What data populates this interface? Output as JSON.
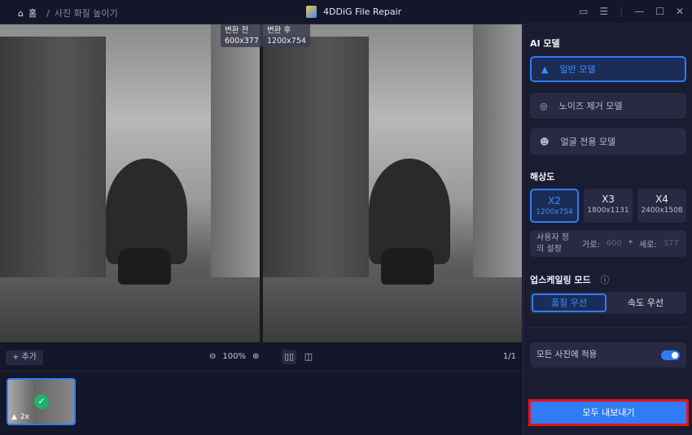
{
  "titlebar": {
    "home": "홈",
    "separator": "/",
    "current": "사진 화질 높이기",
    "app_title": "4DDiG File Repair"
  },
  "viewer": {
    "before_label": "변환 전",
    "before_size": "600x377",
    "after_label": "변환 후",
    "after_size": "1200x754"
  },
  "toolbar": {
    "add": "+ 추가",
    "zoom": "100%",
    "page": "1/1"
  },
  "thumbnail": {
    "scale": "2x"
  },
  "panel": {
    "ai_model_title": "AI 모델",
    "models": [
      {
        "label": "일반 모델"
      },
      {
        "label": "노이즈 제거 모델"
      },
      {
        "label": "얼굴 전용 모델"
      }
    ],
    "resolution_title": "해상도",
    "resolutions": [
      {
        "label": "X2",
        "size": "1200x754"
      },
      {
        "label": "X3",
        "size": "1800x1131"
      },
      {
        "label": "X4",
        "size": "2400x1508"
      }
    ],
    "custom": {
      "label": "사용자 정의 설정",
      "width_label": "가로:",
      "width_placeholder": "600",
      "times": "*",
      "height_label": "세로:",
      "height_placeholder": "377"
    },
    "upscale_title": "업스케일링 모드",
    "modes": [
      "품질 우선",
      "속도 우선"
    ],
    "apply_all": "모든 사진에 적용",
    "apply_all_on": true,
    "export": "모두 내보내기"
  },
  "colors": {
    "accent": "#2f7cf6",
    "highlight": "#e8131d",
    "success": "#20b26b"
  }
}
